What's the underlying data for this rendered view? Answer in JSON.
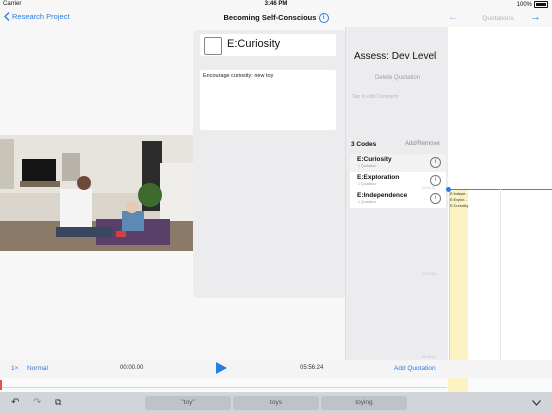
{
  "status_bar": {
    "carrier": "Carrier",
    "time": "3:46 PM",
    "battery": "100%"
  },
  "nav": {
    "back_label": "Research Project",
    "title": "Becoming Self-Conscious",
    "tab_label": "Quotations"
  },
  "code_card": {
    "code_name": "E:Curiosity",
    "note": "Encourage curiosity: new toy"
  },
  "panel": {
    "title": "Assess: Dev Level",
    "delete_label": "Delete Quotation",
    "comment_placeholder": "Tap to edit Comment",
    "codes_count": "3 Codes",
    "add_remove_label": "Add/Remove",
    "codes": [
      {
        "name": "E:Curiosity",
        "sub": "1 Quotation"
      },
      {
        "name": "E:Exploration",
        "sub": "1 Quotation"
      },
      {
        "name": "E:Independence",
        "sub": "1 Quotation"
      }
    ]
  },
  "timeline": {
    "chips": [
      "E:Indepe...",
      "E:Explor...",
      "E:Curiosity"
    ],
    "ticks": [
      "00:01:07",
      "00:03:05",
      "00:05:03"
    ]
  },
  "playback": {
    "speed": "1×",
    "mode": "Normal",
    "start_time": "00:00.00",
    "end_time": "05:56.24",
    "add_label": "Add Quotation"
  },
  "keyboard": {
    "suggestions": [
      "\"toy\"",
      "toys",
      "toying"
    ]
  },
  "colors": {
    "accent": "#2a7de1",
    "timeline_marker": "#e35050",
    "code_bar": "#fbf3c4"
  }
}
